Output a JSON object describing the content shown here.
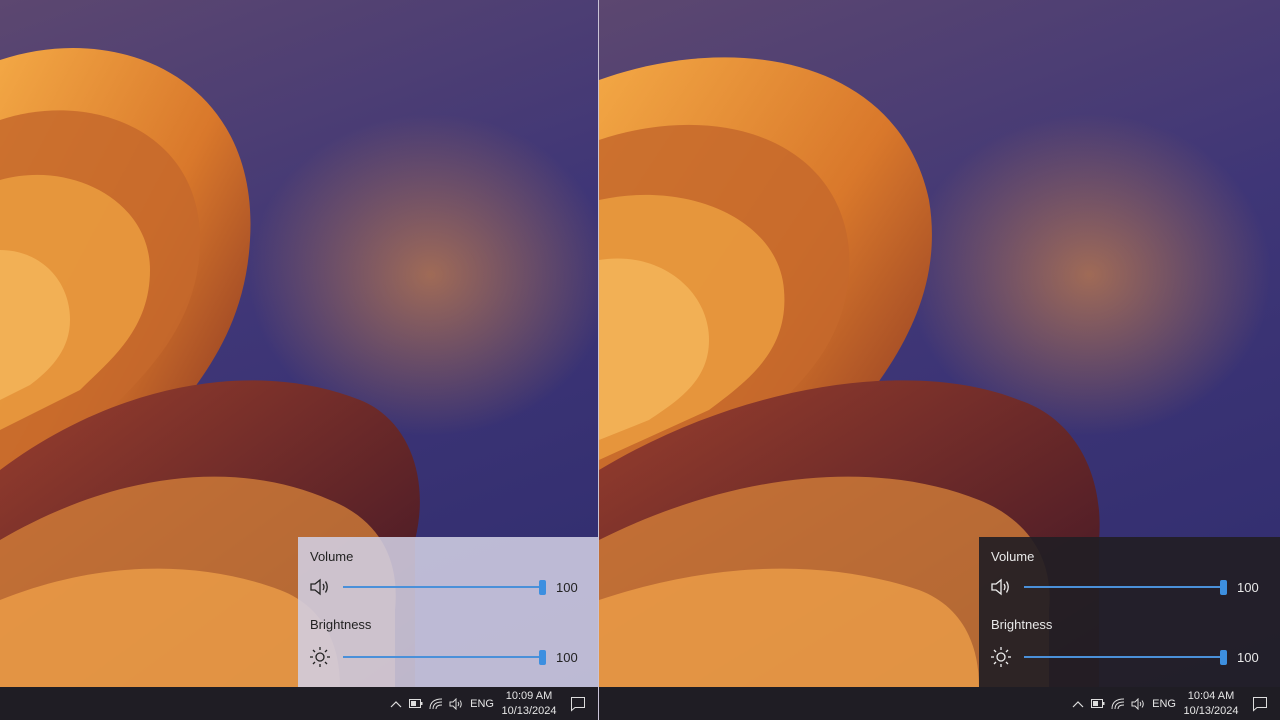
{
  "left": {
    "theme": "light",
    "flyout": {
      "volume": {
        "label": "Volume",
        "value": "100",
        "level": 1.0,
        "icon": "speaker-icon"
      },
      "brightness": {
        "label": "Brightness",
        "value": "100",
        "level": 1.0,
        "icon": "sun-icon"
      }
    },
    "tray": {
      "language": "ENG",
      "time": "10:09 AM",
      "date": "10/13/2024"
    }
  },
  "right": {
    "theme": "dark",
    "flyout": {
      "volume": {
        "label": "Volume",
        "value": "100",
        "level": 1.0,
        "icon": "speaker-icon"
      },
      "brightness": {
        "label": "Brightness",
        "value": "100",
        "level": 1.0,
        "icon": "sun-icon"
      }
    },
    "tray": {
      "language": "ENG",
      "time": "10:04 AM",
      "date": "10/13/2024"
    }
  },
  "colors": {
    "accent": "#3d8fe0",
    "taskbar": "#1f1d24"
  }
}
